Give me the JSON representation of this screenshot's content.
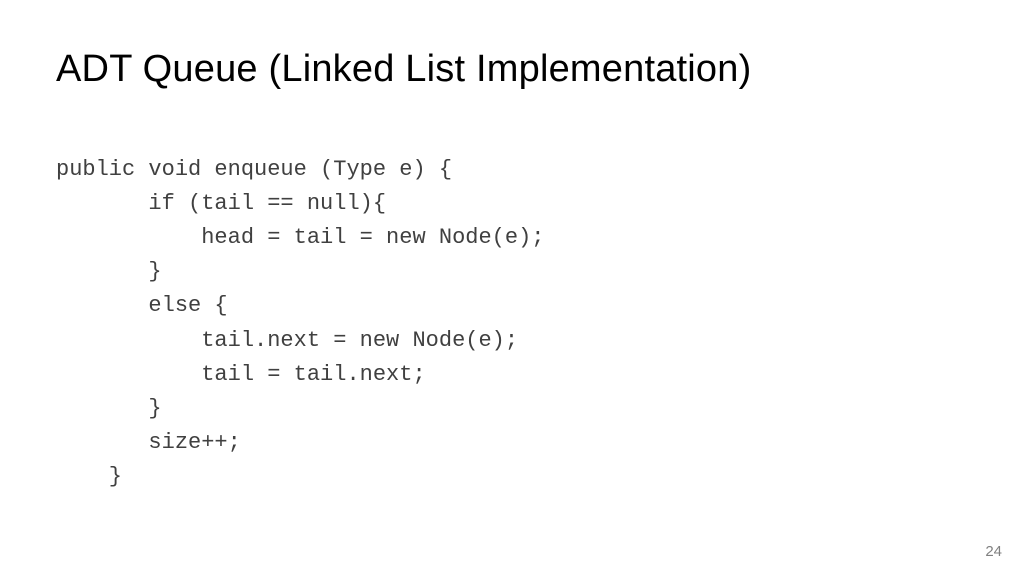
{
  "title": "ADT Queue (Linked List Implementation)",
  "code": {
    "l1": "public void enqueue (Type e) {",
    "l2": "       if (tail == null){",
    "l3": "           head = tail = new Node(e);",
    "l4": "       }",
    "l5": "       else {",
    "l6": "           tail.next = new Node(e);",
    "l7": "           tail = tail.next;",
    "l8": "       }",
    "l9": "       size++;",
    "l10": "    }"
  },
  "page_number": "24"
}
